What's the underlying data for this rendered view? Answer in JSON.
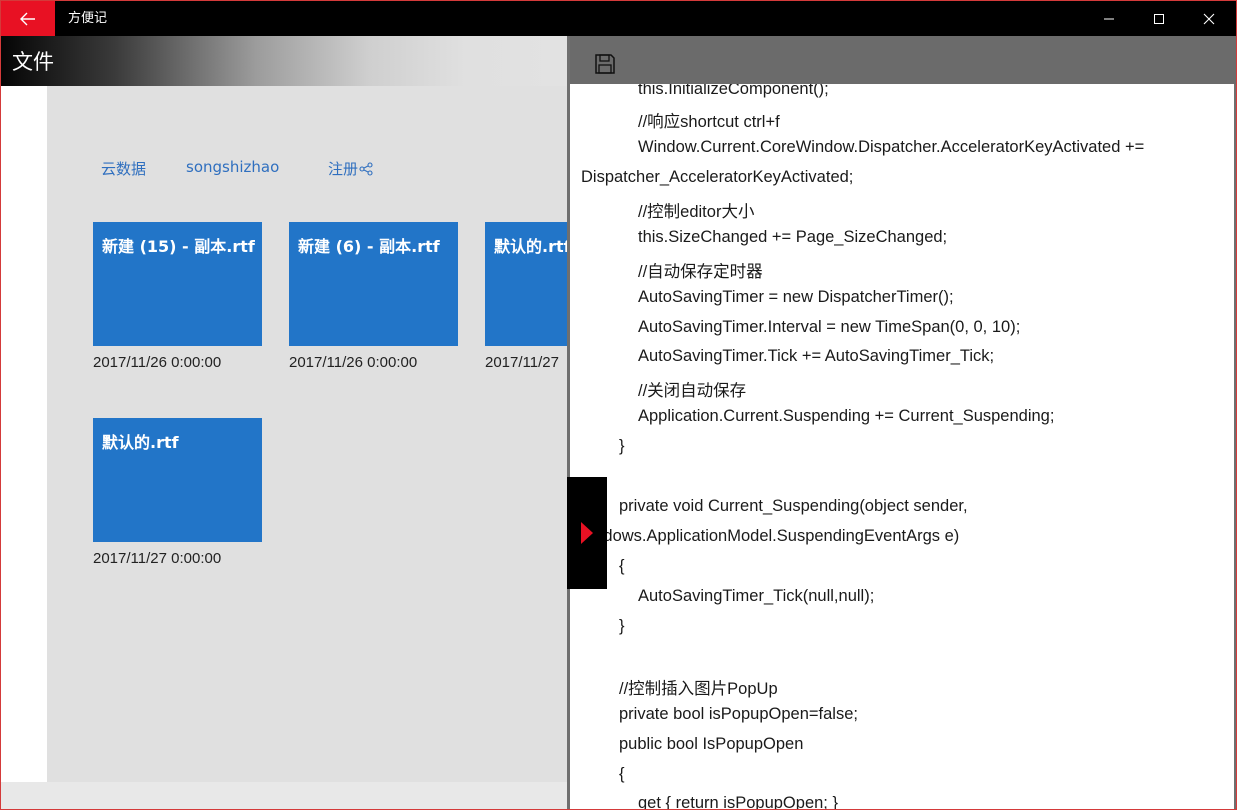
{
  "window": {
    "title": "方便记",
    "controls": {
      "minimize": "minimize-icon",
      "maximize": "maximize-icon",
      "close": "close-icon"
    },
    "colors": {
      "back_button": "#e81123",
      "title_bar": "#000000"
    }
  },
  "left_panel": {
    "header_title": "文件",
    "nav": {
      "cloud": "云数据",
      "user": "songshizhao",
      "register": "注册"
    },
    "files": [
      {
        "name": "新建 (15) - 副本.rtf",
        "date": "2017/11/26 0:00:00"
      },
      {
        "name": "新建 (6) - 副本.rtf",
        "date": "2017/11/26 0:00:00"
      },
      {
        "name": "默认的.rtf",
        "date": "2017/11/27"
      },
      {
        "name": "默认的.rtf",
        "date": "2017/11/27 0:00:00"
      }
    ],
    "colors": {
      "tile": "#2275c8",
      "link": "#2f6fbf"
    }
  },
  "editor": {
    "toolbar": {
      "save_icon": "save-icon"
    },
    "lines": [
      "this.InitializeComponent();",
      "//响应shortcut ctrl+f",
      "Window.Current.CoreWindow.Dispatcher.AcceleratorKeyActivated +=",
      "Dispatcher_AcceleratorKeyActivated;",
      "//控制editor大小",
      "this.SizeChanged += Page_SizeChanged;",
      "//自动保存定时器",
      "AutoSavingTimer = new DispatcherTimer();",
      "AutoSavingTimer.Interval = new TimeSpan(0, 0, 10);",
      "AutoSavingTimer.Tick += AutoSavingTimer_Tick;",
      "//关闭自动保存",
      "Application.Current.Suspending += Current_Suspending;",
      "}",
      "private void Current_Suspending(object sender,",
      "Windows.ApplicationModel.SuspendingEventArgs e)",
      "{",
      "AutoSavingTimer_Tick(null,null);",
      "}",
      "//控制插入图片PopUp",
      "private bool isPopupOpen=false;",
      "public bool IsPopupOpen",
      "{",
      "get { return isPopupOpen; }"
    ]
  },
  "toggle": {
    "icon": "chevron-right-icon",
    "color": "#e81123"
  }
}
